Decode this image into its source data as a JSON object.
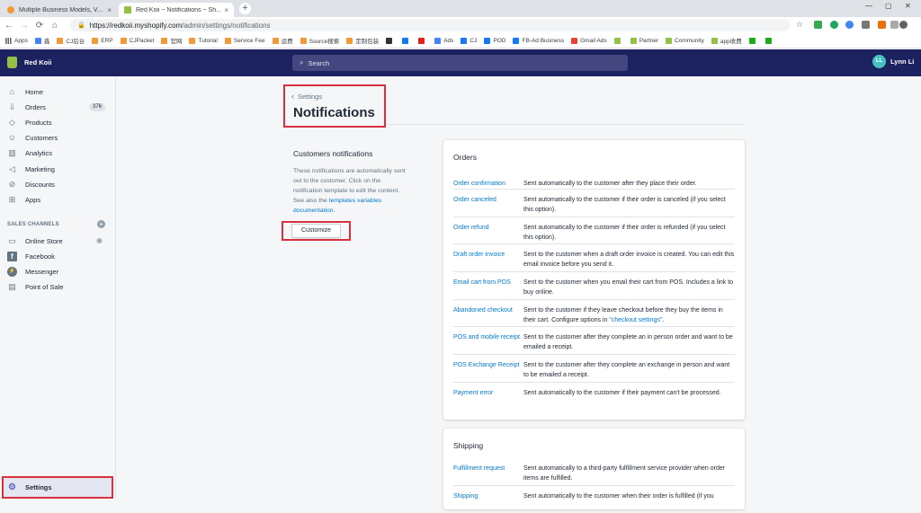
{
  "browser": {
    "tabs": [
      {
        "label": "Multiple Business Models, Va...",
        "active": false
      },
      {
        "label": "Red Koii ~ Notifications ~ Sh...",
        "active": true
      }
    ],
    "url_host": "https://redkoii.myshopify.com",
    "url_path": "/admin/settings/notifications",
    "bookmarks": [
      "Apps",
      "鑫",
      "CJ后台",
      "ERP",
      "CJPacket",
      "官网",
      "Tutorial",
      "Service Fee",
      "运费",
      "Source搜索",
      "定制包装",
      "",
      "",
      "",
      "Ads",
      "CJ",
      "POD",
      "FB-Ad Business",
      "Gmail Ads",
      "",
      "Partner",
      "Community",
      "app收费",
      "",
      ""
    ]
  },
  "topbar": {
    "store_name": "Red Koii",
    "search_placeholder": "Search",
    "user_initials": "LL",
    "user_name": "Lynn Li"
  },
  "sidebar": {
    "items": [
      {
        "label": "Home",
        "icon": "home-icon"
      },
      {
        "label": "Orders",
        "icon": "orders-icon",
        "badge": "376"
      },
      {
        "label": "Products",
        "icon": "tag-icon"
      },
      {
        "label": "Customers",
        "icon": "person-icon"
      },
      {
        "label": "Analytics",
        "icon": "chart-icon"
      },
      {
        "label": "Marketing",
        "icon": "megaphone-icon"
      },
      {
        "label": "Discounts",
        "icon": "discount-icon"
      },
      {
        "label": "Apps",
        "icon": "apps-icon"
      }
    ],
    "channels_title": "SALES CHANNELS",
    "channels": [
      {
        "label": "Online Store",
        "icon": "store-icon"
      },
      {
        "label": "Facebook",
        "icon": "facebook-icon"
      },
      {
        "label": "Messenger",
        "icon": "messenger-icon"
      },
      {
        "label": "Point of Sale",
        "icon": "pos-icon"
      }
    ],
    "settings_label": "Settings"
  },
  "main": {
    "breadcrumb": "Settings",
    "title": "Notifications",
    "section_title": "Customers notifications",
    "section_desc_prefix": "These notifications are automatically sent out to the customer. Click on the notification template to edit the content. See also the ",
    "section_desc_link": "templates variables documentation",
    "section_desc_suffix": ".",
    "customize_label": "Customize"
  },
  "orders_card": {
    "title": "Orders",
    "rows": [
      {
        "name": "Order confirmation",
        "desc": "Sent automatically to the customer after they place their order."
      },
      {
        "name": "Order canceled",
        "desc": "Sent automatically to the customer if their order is canceled (if you select this option)."
      },
      {
        "name": "Order refund",
        "desc": "Sent automatically to the customer if their order is refunded (if you select this option)."
      },
      {
        "name": "Draft order invoice",
        "desc": "Sent to the customer when a draft order invoice is created. You can edit this email invoice before you send it."
      },
      {
        "name": "Email cart from POS",
        "desc": "Sent to the customer when you email their cart from POS. Includes a link to buy online."
      },
      {
        "name": "Abandoned checkout",
        "desc": "Sent to the customer if they leave checkout before they buy the items in their cart. Configure options in ",
        "link": "\"checkout settings\"",
        "suffix": "."
      },
      {
        "name": "POS and mobile receipt",
        "desc": "Sent to the customer after they complete an in person order and want to be emailed a receipt."
      },
      {
        "name": "POS Exchange Receipt",
        "desc": "Sent to the customer after they complete an exchange in person and want to be emailed a receipt."
      },
      {
        "name": "Payment error",
        "desc": "Sent automatically to the customer if their payment can't be processed."
      }
    ]
  },
  "shipping_card": {
    "title": "Shipping",
    "rows": [
      {
        "name": "Fulfillment request",
        "desc": "Sent automatically to a third-party fulfillment service provider when order items are fulfilled."
      },
      {
        "name": "Shipping",
        "desc": "Sent automatically to the customer when their order is fulfilled (if you"
      }
    ]
  },
  "colors": {
    "topbar": "#1c2260",
    "link": "#007ace",
    "highlight": "#d9303e",
    "shopify_green": "#95bf47"
  }
}
